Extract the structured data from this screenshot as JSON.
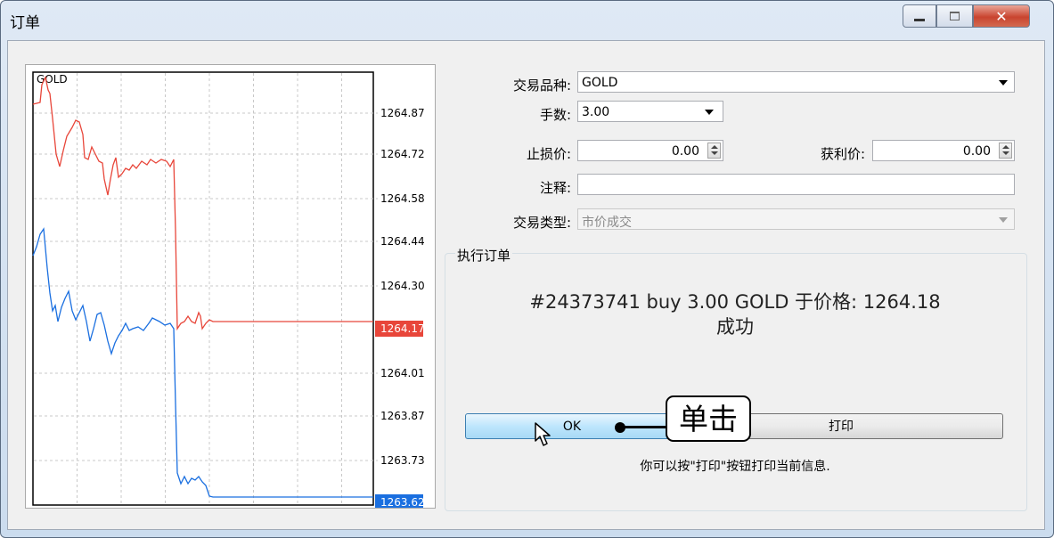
{
  "window": {
    "title": "订单",
    "controls": {
      "minimize": "minimize-icon",
      "maximize": "maximize-icon",
      "close": "close-icon"
    }
  },
  "chart": {
    "symbol": "GOLD",
    "price_labels": [
      "1264.87",
      "1264.72",
      "1264.58",
      "1264.44",
      "1264.30",
      "1264.17",
      "1264.01",
      "1263.87",
      "1263.73",
      "1263.62"
    ],
    "bid_label": "1264.17",
    "ask_label": "1263.62",
    "colors": {
      "upper_line": "#e8463a",
      "lower_line": "#1a6fe0"
    }
  },
  "form": {
    "symbol_label": "交易品种:",
    "symbol_value": "GOLD",
    "volume_label": "手数:",
    "volume_value": "3.00",
    "sl_label": "止损价:",
    "sl_value": "0.00",
    "tp_label": "获利价:",
    "tp_value": "0.00",
    "comment_label": "注释:",
    "comment_value": "",
    "type_label": "交易类型:",
    "type_value": "市价成交"
  },
  "result": {
    "group_title": "执行订单",
    "message": "#24373741 buy 3.00 GOLD 于价格: 1264.18",
    "status": "成功",
    "ok_label": "OK",
    "print_label": "打印",
    "hint": "你可以按\"打印\"按钮打印当前信息."
  },
  "annotation": {
    "callout": "单击"
  }
}
